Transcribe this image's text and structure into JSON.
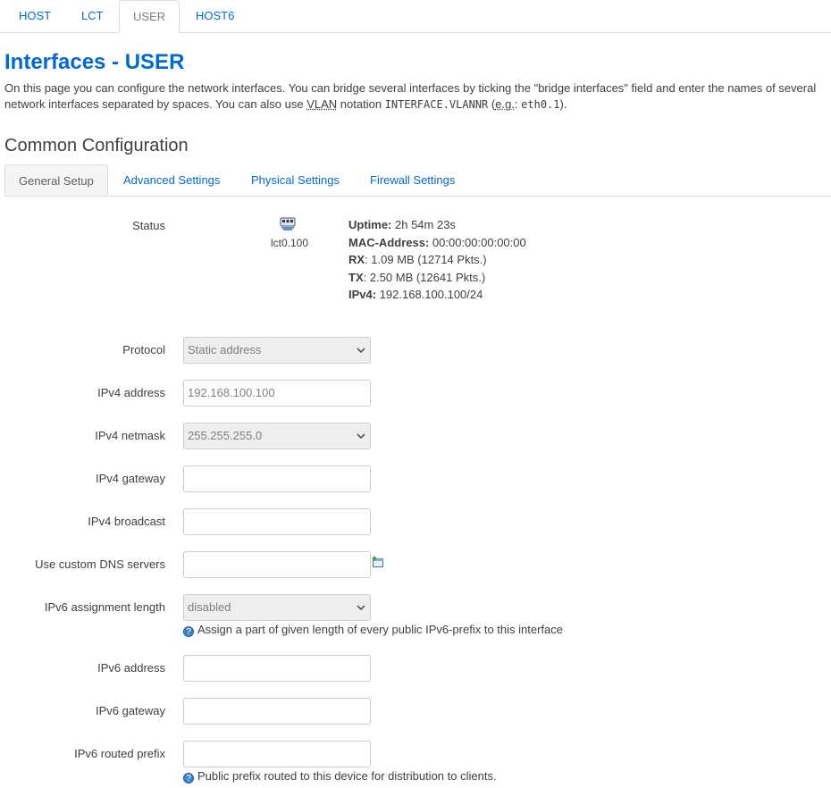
{
  "top_tabs": [
    "HOST",
    "LCT",
    "USER",
    "HOST6"
  ],
  "page": {
    "title": "Interfaces - USER",
    "desc_part1": "On this page you can configure the network interfaces. You can bridge several interfaces by ticking the \"bridge interfaces\" field and enter the names of several network interfaces separated by spaces. You can also use ",
    "desc_vlan": "VLAN",
    "desc_part2": " notation ",
    "desc_code1": "INTERFACE.VLANNR",
    "desc_part3": " (",
    "desc_eg": "e.g.",
    "desc_part4": ": ",
    "desc_code2": "eth0.1",
    "desc_part5": ")."
  },
  "section_title": "Common Configuration",
  "sub_tabs": [
    "General Setup",
    "Advanced Settings",
    "Physical Settings",
    "Firewall Settings"
  ],
  "status": {
    "label": "Status",
    "device": "lct0.100",
    "uptime_label": "Uptime:",
    "uptime": " 2h 54m 23s",
    "mac_label": "MAC-Address:",
    "mac": " 00:00:00:00:00:00",
    "rx_label": "RX",
    "rx": ": 1.09 MB (12714 Pkts.)",
    "tx_label": "TX",
    "tx": ": 2.50 MB (12641 Pkts.)",
    "ipv4_label": "IPv4:",
    "ipv4": " 192.168.100.100/24"
  },
  "form": {
    "protocol_label": "Protocol",
    "protocol_value": "Static address",
    "ipv4_address_label": "IPv4 address",
    "ipv4_address_value": "192.168.100.100",
    "ipv4_netmask_label": "IPv4 netmask",
    "ipv4_netmask_value": "255.255.255.0",
    "ipv4_gateway_label": "IPv4 gateway",
    "ipv4_gateway_value": "",
    "ipv4_broadcast_label": "IPv4 broadcast",
    "ipv4_broadcast_value": "",
    "dns_label": "Use custom DNS servers",
    "dns_value": "",
    "ipv6_assign_label": "IPv6 assignment length",
    "ipv6_assign_value": "disabled",
    "ipv6_assign_hint": "Assign a part of given length of every public IPv6-prefix to this interface",
    "ipv6_address_label": "IPv6 address",
    "ipv6_address_value": "",
    "ipv6_gateway_label": "IPv6 gateway",
    "ipv6_gateway_value": "",
    "ipv6_prefix_label": "IPv6 routed prefix",
    "ipv6_prefix_value": "",
    "ipv6_prefix_hint": "Public prefix routed to this device for distribution to clients."
  },
  "colors": {
    "accent": "#0069d6",
    "text": "#404040",
    "border": "#dddddd"
  },
  "icons": {
    "status": "network-device-icon",
    "add": "add-entry-icon",
    "help": "help-icon"
  }
}
